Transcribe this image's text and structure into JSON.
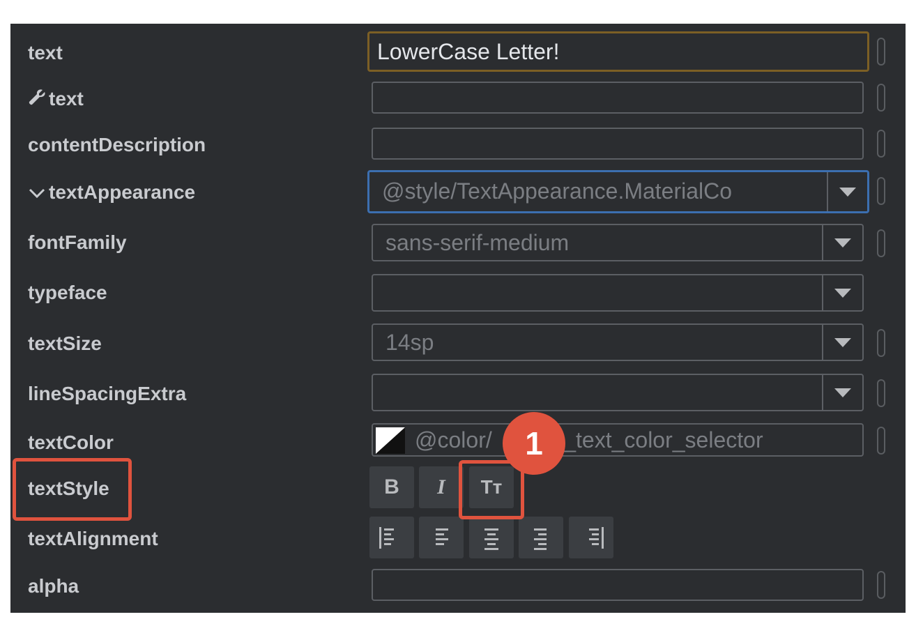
{
  "attributes": {
    "text": {
      "label": "text",
      "value": "LowerCase Letter!"
    },
    "tools_text": {
      "label": "text",
      "value": ""
    },
    "content_description": {
      "label": "contentDescription",
      "value": ""
    },
    "text_appearance": {
      "label": "textAppearance",
      "value": "@style/TextAppearance.MaterialCo"
    },
    "font_family": {
      "label": "fontFamily",
      "value": "sans-serif-medium"
    },
    "typeface": {
      "label": "typeface",
      "value": ""
    },
    "text_size": {
      "label": "textSize",
      "value": "14sp"
    },
    "line_spacing_extra": {
      "label": "lineSpacingExtra",
      "value": ""
    },
    "text_color": {
      "label": "textColor",
      "value": "@color/",
      "value_rest": "btn_text_color_selector"
    },
    "text_style": {
      "label": "textStyle",
      "bold": "B",
      "italic": "I",
      "all_caps": "Tт"
    },
    "text_alignment": {
      "label": "textAlignment"
    },
    "alpha": {
      "label": "alpha",
      "value": ""
    }
  },
  "callout": {
    "number": "1"
  },
  "icons": {
    "tools_text": "wrench-icon",
    "expand": "chevron-down-icon",
    "dropdown": "triangle-down-icon",
    "align": [
      "align-view-start-icon",
      "align-text-start-icon",
      "align-center-icon",
      "align-text-end-icon",
      "align-view-end-icon"
    ]
  },
  "colors": {
    "panel_bg": "#2b2d30",
    "highlight": "#e0533e",
    "active_border": "#7c5f25",
    "focus_border": "#3c6fb0"
  }
}
